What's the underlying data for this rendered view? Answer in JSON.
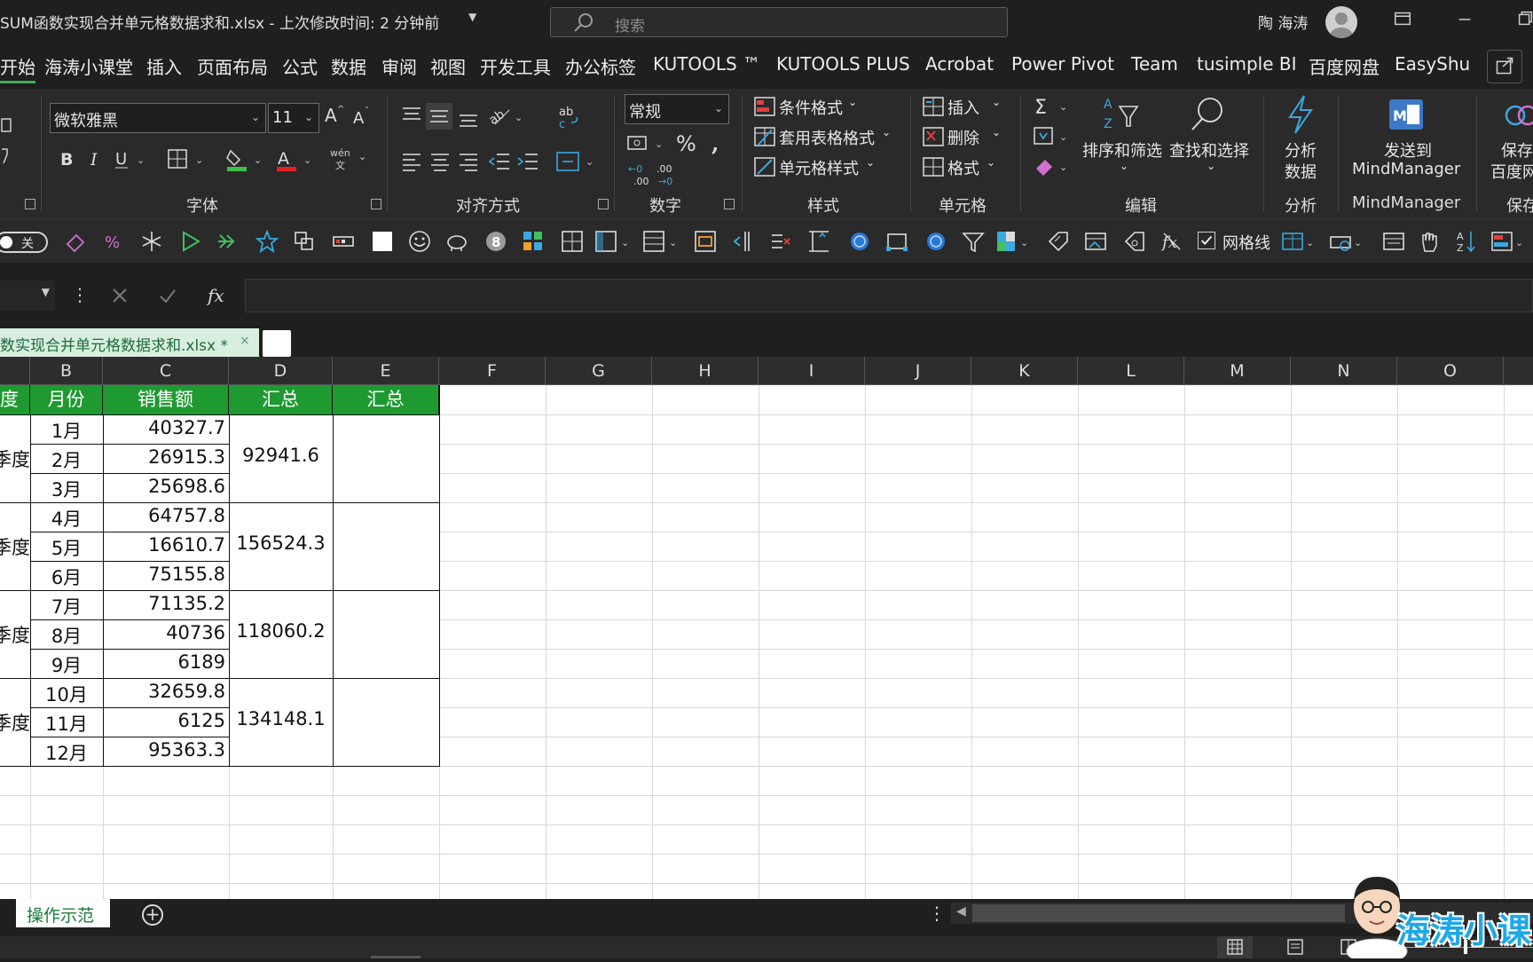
{
  "titlebar": {
    "title": "SUM函数实现合并单元格数据求和.xlsx  -  上次修改时间: 2 分钟前",
    "search_placeholder": "搜索",
    "user_name": "陶 海涛"
  },
  "menu": {
    "tabs": [
      "开始",
      "海涛小课堂",
      "插入",
      "页面布局",
      "公式",
      "数据",
      "审阅",
      "视图",
      "开发工具",
      "办公标签",
      "KUTOOLS ™",
      "KUTOOLS PLUS",
      "Acrobat",
      "Power Pivot",
      "Team",
      "tusimple BI",
      "百度网盘",
      "EasyShu"
    ],
    "active": "开始"
  },
  "ribbon": {
    "font_name": "微软雅黑",
    "font_size": "11",
    "wen_label": "wén",
    "wen_char": "文",
    "number_format": "常规",
    "group_font": "字体",
    "group_align": "对齐方式",
    "group_number": "数字",
    "group_style": "样式",
    "group_cells": "单元格",
    "group_edit": "编辑",
    "group_analysis": "分析",
    "group_mindmanager": "MindManager",
    "group_save": "保存",
    "cond_format": "条件格式",
    "table_format": "套用表格格式",
    "cell_style": "单元格样式",
    "insert": "插入",
    "delete": "删除",
    "format": "格式",
    "sort_filter": "排序和筛选",
    "find_select": "查找和选择",
    "analyze_data_1": "分析",
    "analyze_data_2": "数据",
    "send_to_1": "发送到",
    "send_to_2": "MindManager",
    "save_baidu_1": "保存到",
    "save_baidu_2": "百度网"
  },
  "qat": {
    "toggle_label": "关",
    "gridline_label": "网格线"
  },
  "workbook_tab": {
    "label": "数实现合并单元格数据求和.xlsx *",
    "close": "×"
  },
  "columns": [
    "B",
    "C",
    "D",
    "E",
    "F",
    "G",
    "H",
    "I",
    "J",
    "K",
    "L",
    "M",
    "N",
    "O"
  ],
  "table": {
    "headers": [
      "度",
      "月份",
      "销售额",
      "汇总",
      "汇总"
    ],
    "quarter_label": "季度",
    "months": [
      "1月",
      "2月",
      "3月",
      "4月",
      "5月",
      "6月",
      "7月",
      "8月",
      "9月",
      "10月",
      "11月",
      "12月"
    ],
    "sales": [
      "40327.7",
      "26915.3",
      "25698.6",
      "64757.8",
      "16610.7",
      "75155.8",
      "71135.2",
      "40736",
      "6189",
      "32659.8",
      "6125",
      "95363.3"
    ],
    "totals": [
      "92941.6",
      "156524.3",
      "118060.2",
      "134148.1"
    ]
  },
  "sheet_tab": "操作示范",
  "watermark": "海涛小课",
  "colors": {
    "header_green": "#1e9a31",
    "accent": "#3fae5f",
    "watermark_blue": "#1ea8e8"
  }
}
